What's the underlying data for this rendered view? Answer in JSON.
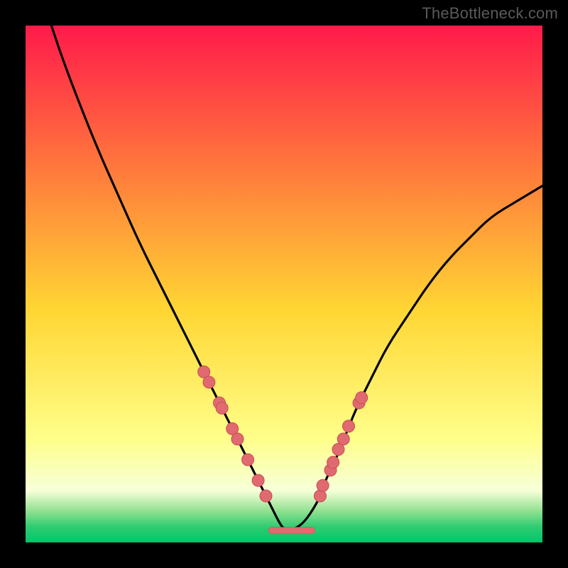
{
  "watermark": "TheBottleneck.com",
  "colors": {
    "gradient_top": "#ff1a4a",
    "gradient_mid_upper": "#ff7a3c",
    "gradient_mid": "#ffd633",
    "gradient_lower": "#ffff8a",
    "gradient_pale": "#f7ffd9",
    "gradient_green1": "#8fe08f",
    "gradient_green2": "#2ecc71",
    "gradient_green3": "#00c76a",
    "curve": "#000000",
    "marker_fill": "#e06a6f",
    "marker_stroke": "#c94c55",
    "trough_fill": "#e06a6f"
  },
  "chart_data": {
    "type": "line",
    "title": "",
    "xlabel": "",
    "ylabel": "",
    "xlim": [
      0,
      100
    ],
    "ylim": [
      0,
      100
    ],
    "curve": {
      "x": [
        5,
        7,
        10,
        14,
        18,
        22,
        26,
        30,
        33,
        36,
        38,
        40,
        42,
        44,
        46,
        48,
        49,
        50,
        52,
        54,
        56,
        57,
        58,
        60,
        62,
        64,
        67,
        70,
        74,
        78,
        82,
        86,
        90,
        95,
        100
      ],
      "y": [
        100,
        94,
        86,
        76,
        67,
        58,
        50,
        42,
        36,
        30,
        26,
        22,
        18,
        14,
        10,
        6,
        4,
        2.5,
        2.5,
        4,
        7,
        9,
        12,
        16,
        21,
        26,
        32,
        38,
        44,
        50,
        55,
        59,
        63,
        66,
        69
      ]
    },
    "left_markers_xy": [
      [
        34.5,
        33
      ],
      [
        35.5,
        31
      ],
      [
        37.5,
        27
      ],
      [
        38,
        26
      ],
      [
        40,
        22
      ],
      [
        41,
        20
      ],
      [
        43,
        16
      ],
      [
        45,
        12
      ],
      [
        46.5,
        9
      ]
    ],
    "right_markers_xy": [
      [
        57,
        9
      ],
      [
        57.5,
        11
      ],
      [
        59,
        14
      ],
      [
        59.5,
        15.5
      ],
      [
        60.5,
        18
      ],
      [
        61.5,
        20
      ],
      [
        62.5,
        22.5
      ],
      [
        64.5,
        27
      ],
      [
        65,
        28
      ]
    ],
    "trough_bar": {
      "x_start": 47,
      "x_end": 56,
      "y": 2.3,
      "thickness_pct": 1.3
    }
  }
}
